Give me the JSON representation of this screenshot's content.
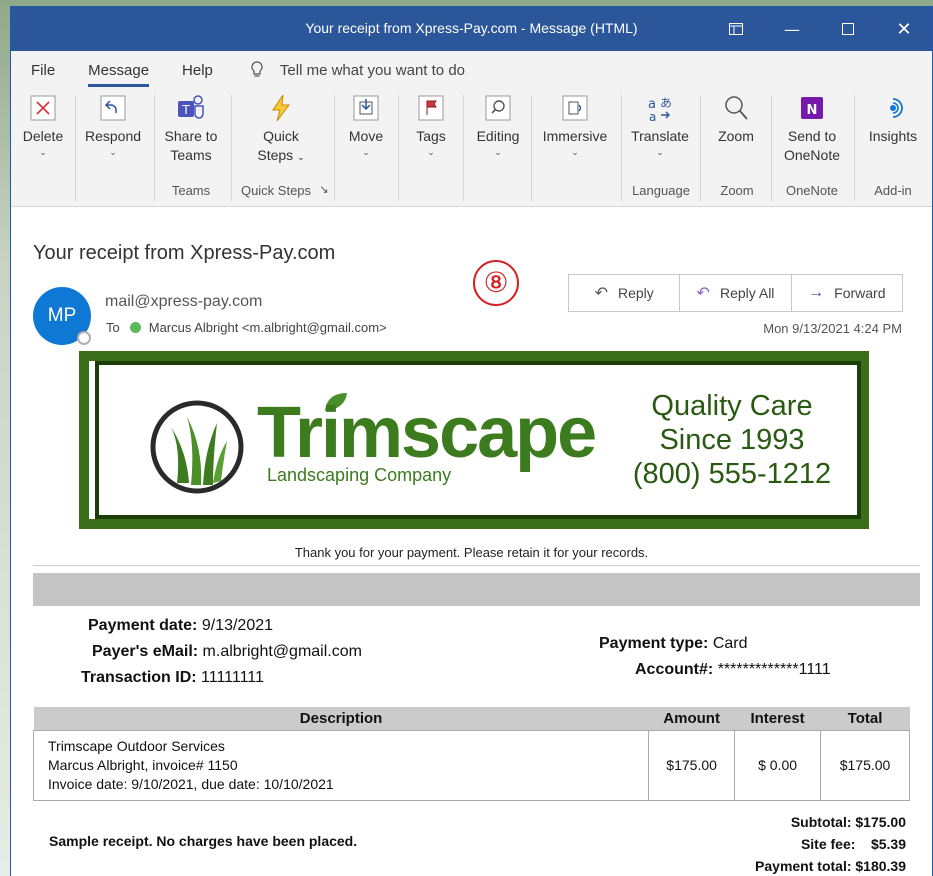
{
  "window": {
    "title": "Your receipt from Xpress-Pay.com  -  Message (HTML)"
  },
  "menu": {
    "tabs": [
      "File",
      "Message",
      "Help"
    ],
    "active_tab": "Message",
    "tell_me": "Tell me what you want to do"
  },
  "ribbon": {
    "delete": "Delete",
    "respond": "Respond",
    "share_line1": "Share to",
    "share_line2": "Teams",
    "quick_line1": "Quick",
    "quick_line2": "Steps",
    "move": "Move",
    "tags": "Tags",
    "editing": "Editing",
    "immersive": "Immersive",
    "translate": "Translate",
    "zoom": "Zoom",
    "onenote_line1": "Send to",
    "onenote_line2": "OneNote",
    "insights": "Insights",
    "groups": {
      "teams": "Teams",
      "quick_steps": "Quick Steps",
      "language": "Language",
      "zoom": "Zoom",
      "onenote": "OneNote",
      "addin": "Add-in"
    }
  },
  "message": {
    "subject": "Your receipt from Xpress-Pay.com",
    "annotation": "⑧",
    "avatar_initials": "MP",
    "from": "mail@xpress-pay.com",
    "to_label": "To",
    "to": "Marcus Albright <m.albright@gmail.com>",
    "date": "Mon 9/13/2021 4:24 PM",
    "reply": "Reply",
    "reply_all": "Reply All",
    "forward": "Forward"
  },
  "banner": {
    "brand": "Trimscape",
    "tagline": "Landscaping Company",
    "line1": "Quality Care",
    "line2": "Since 1993",
    "line3": "(800) 555-1212"
  },
  "receipt": {
    "thanks": "Thank you for your payment. Please retain it for your records.",
    "payment_date_label": "Payment date:",
    "payment_date": "9/13/2021",
    "payer_email_label": "Payer's eMail:",
    "payer_email": "m.albright@gmail.com",
    "transaction_label": "Transaction ID:",
    "transaction_id": "11111111",
    "payment_type_label": "Payment type:",
    "payment_type": "Card",
    "account_label": "Account#:",
    "account": "*************1111",
    "table": {
      "headers": [
        "Description",
        "Amount",
        "Interest",
        "Total"
      ],
      "desc_line1": "Trimscape Outdoor Services",
      "desc_line2": "Marcus Albright, invoice# 1150",
      "desc_line3": "Invoice date: 9/10/2021, due date: 10/10/2021",
      "amount": "$175.00",
      "interest": "$ 0.00",
      "total": "$175.00"
    },
    "sample_note": "Sample receipt. No charges have been placed.",
    "subtotal": "Subtotal: $175.00",
    "site_fee": "Site fee:    $5.39",
    "payment_total": "Payment total: $180.39"
  }
}
